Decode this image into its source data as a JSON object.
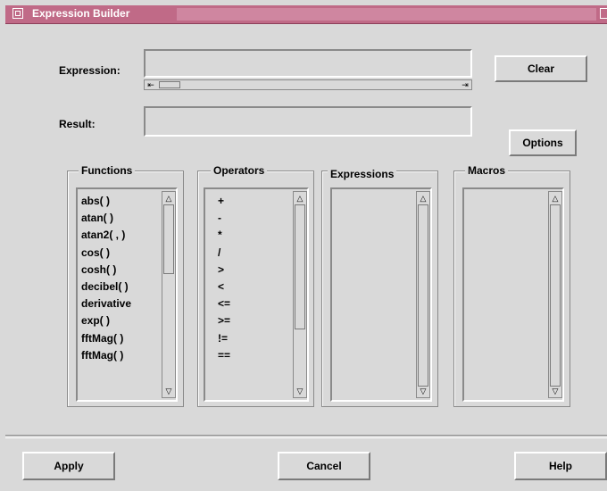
{
  "window": {
    "title": "Expression Builder"
  },
  "expression": {
    "label": "Expression:",
    "value": "",
    "scroll_left": "⇤",
    "scroll_right": "⇥"
  },
  "result": {
    "label": "Result:",
    "value": ""
  },
  "buttons": {
    "clear": "Clear",
    "options": "Options",
    "apply": "Apply",
    "cancel": "Cancel",
    "help": "Help"
  },
  "groups": {
    "functions": {
      "title": "Functions",
      "items": [
        "abs( )",
        "atan( )",
        "atan2( , )",
        "cos( )",
        "cosh( )",
        "decibel( )",
        "derivative",
        "exp( )",
        "fftMag( )",
        "fftMag( )"
      ]
    },
    "operators": {
      "title": "Operators",
      "items": [
        "+",
        "-",
        "*",
        "/",
        ">",
        "<",
        "<=",
        ">=",
        "!=",
        "=="
      ]
    },
    "expressions": {
      "title": "Expressions",
      "items": []
    },
    "macros": {
      "title": "Macros",
      "items": []
    }
  },
  "icons": {
    "scroll_up": "△",
    "scroll_down": "▽",
    "window_menu": "window-menu-icon",
    "close": "close-icon"
  }
}
